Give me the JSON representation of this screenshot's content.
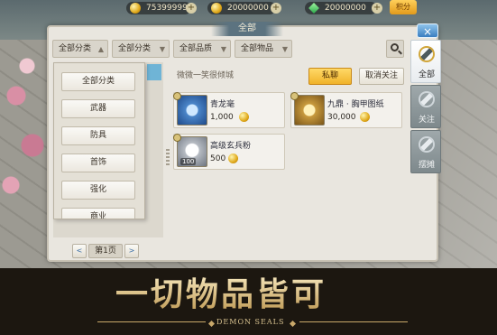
{
  "resources": [
    {
      "id": "silver",
      "value": "75399999"
    },
    {
      "id": "gold",
      "value": "20000000"
    },
    {
      "id": "jade",
      "value": "20000000"
    }
  ],
  "topbar": {
    "recharge_label": "积分"
  },
  "panel": {
    "title": "全部",
    "filters": [
      "全部分类",
      "全部分类",
      "全部品质",
      "全部物品"
    ],
    "dropdown_items": [
      "全部分类",
      "武器",
      "防具",
      "首饰",
      "强化",
      "商业"
    ],
    "seller": {
      "name": "微微一笑很倾城",
      "chat_label": "私聊",
      "unfollow_label": "取消关注"
    },
    "items": [
      {
        "name": "青龙毫",
        "price": "1,000",
        "qty": ""
      },
      {
        "name": "九鼎 · 胸甲图纸",
        "price": "30,000",
        "qty": ""
      },
      {
        "name": "高级玄兵粉",
        "price": "500",
        "qty": "100"
      }
    ],
    "pager": {
      "prev": "<",
      "label": "第1页",
      "next": ">"
    }
  },
  "side_tabs": [
    {
      "label": "全部",
      "active": true
    },
    {
      "label": "关注",
      "active": false
    },
    {
      "label": "摆摊",
      "active": false
    }
  ],
  "banner": {
    "title": "一切物品皆可",
    "subtitle": "DEMON SEALS"
  },
  "colors": {
    "accent_gold": "#f0b32a",
    "tab_blue": "#3b7fc0",
    "banner_gold": "#d6c08e"
  }
}
